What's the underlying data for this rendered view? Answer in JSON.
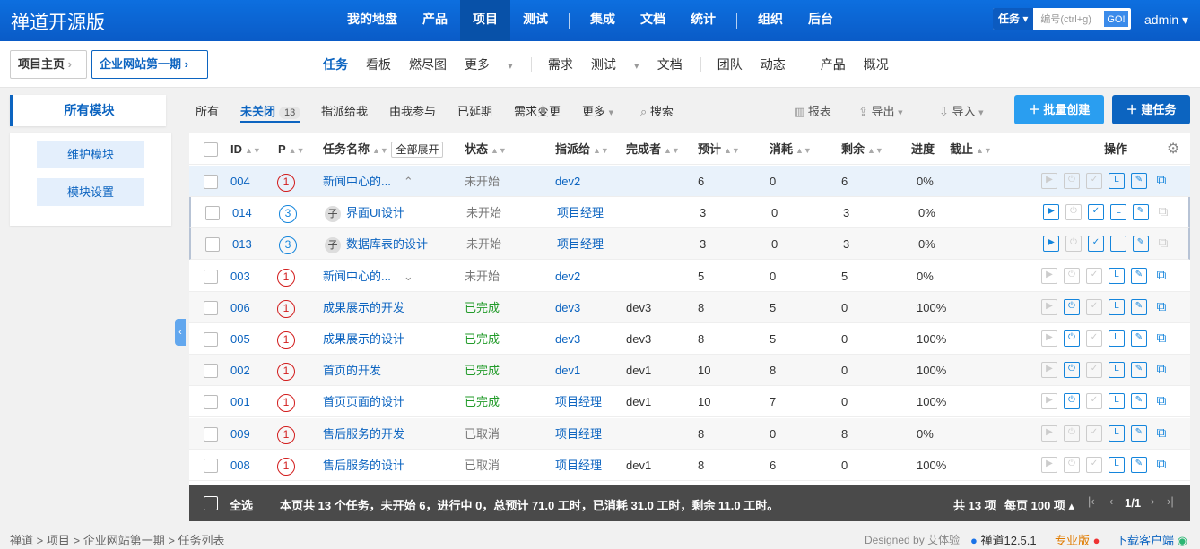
{
  "app": {
    "title": "禅道开源版",
    "nav": [
      "我的地盘",
      "产品",
      "项目",
      "测试",
      "集成",
      "文档",
      "统计",
      "组织",
      "后台"
    ],
    "active_nav": "项目",
    "search_type": "任务",
    "search_placeholder": "编号(ctrl+g)",
    "go": "GO!",
    "user": "admin"
  },
  "breadcrumbs": {
    "home": "项目主页",
    "project": "企业网站第一期"
  },
  "subnav": [
    "任务",
    "看板",
    "燃尽图",
    "更多",
    "需求",
    "测试",
    "文档",
    "团队",
    "动态",
    "产品",
    "概况"
  ],
  "sidebar": {
    "title": "所有模块",
    "buttons": [
      "维护模块",
      "模块设置"
    ]
  },
  "filters": {
    "items": [
      "所有",
      "未关闭",
      "指派给我",
      "由我参与",
      "已延期",
      "需求变更",
      "更多",
      "搜索"
    ],
    "active": "未关闭",
    "count": "13",
    "report": "报表",
    "export": "导出",
    "import": "导入",
    "batch_create": "批量创建",
    "create": "建任务"
  },
  "table": {
    "headers": {
      "id": "ID",
      "p": "P",
      "name": "任务名称",
      "expand": "全部展开",
      "status": "状态",
      "assigned": "指派给",
      "finished": "完成者",
      "estimate": "预计",
      "consumed": "消耗",
      "left": "剩余",
      "progress": "进度",
      "deadline": "截止",
      "ops": "操作"
    },
    "rows": [
      {
        "id": "004",
        "p": "1",
        "name": "新闻中心的...",
        "child": "",
        "status": "未开始",
        "assigned": "dev2",
        "finished": "",
        "est": "6",
        "con": "0",
        "left": "6",
        "prog": "0%"
      },
      {
        "id": "014",
        "p": "3",
        "name": "界面UI设计",
        "child": "子",
        "status": "未开始",
        "assigned": "项目经理",
        "finished": "",
        "est": "3",
        "con": "0",
        "left": "3",
        "prog": "0%"
      },
      {
        "id": "013",
        "p": "3",
        "name": "数据库表的设计",
        "child": "子",
        "status": "未开始",
        "assigned": "项目经理",
        "finished": "",
        "est": "3",
        "con": "0",
        "left": "3",
        "prog": "0%"
      },
      {
        "id": "003",
        "p": "1",
        "name": "新闻中心的...",
        "child": "",
        "status": "未开始",
        "assigned": "dev2",
        "finished": "",
        "est": "5",
        "con": "0",
        "left": "5",
        "prog": "0%"
      },
      {
        "id": "006",
        "p": "1",
        "name": "成果展示的开发",
        "child": "",
        "status": "已完成",
        "assigned": "dev3",
        "finished": "dev3",
        "est": "8",
        "con": "5",
        "left": "0",
        "prog": "100%"
      },
      {
        "id": "005",
        "p": "1",
        "name": "成果展示的设计",
        "child": "",
        "status": "已完成",
        "assigned": "dev3",
        "finished": "dev3",
        "est": "8",
        "con": "5",
        "left": "0",
        "prog": "100%"
      },
      {
        "id": "002",
        "p": "1",
        "name": "首页的开发",
        "child": "",
        "status": "已完成",
        "assigned": "dev1",
        "finished": "dev1",
        "est": "10",
        "con": "8",
        "left": "0",
        "prog": "100%"
      },
      {
        "id": "001",
        "p": "1",
        "name": "首页页面的设计",
        "child": "",
        "status": "已完成",
        "assigned": "项目经理",
        "finished": "dev1",
        "est": "10",
        "con": "7",
        "left": "0",
        "prog": "100%"
      },
      {
        "id": "009",
        "p": "1",
        "name": "售后服务的开发",
        "child": "",
        "status": "已取消",
        "assigned": "项目经理",
        "finished": "",
        "est": "8",
        "con": "0",
        "left": "8",
        "prog": "0%"
      },
      {
        "id": "008",
        "p": "1",
        "name": "售后服务的设计",
        "child": "",
        "status": "已取消",
        "assigned": "项目经理",
        "finished": "dev1",
        "est": "8",
        "con": "6",
        "left": "0",
        "prog": "100%"
      }
    ]
  },
  "footer": {
    "select_all": "全选",
    "summary": "本页共 13 个任务，未开始 6，进行中 0，总预计 71.0 工时，已消耗 31.0 工时，剩余 11.0 工时。",
    "total": "共 13 项",
    "per_page": "每页 100 项",
    "page": "1/1"
  },
  "status_bar": {
    "crumbs": [
      "禅道",
      "项目",
      "企业网站第一期",
      "任务列表"
    ],
    "designed": "Designed by",
    "designer": "艾体验",
    "version": "禅道12.5.1",
    "pro": "专业版",
    "download": "下载客户端"
  }
}
